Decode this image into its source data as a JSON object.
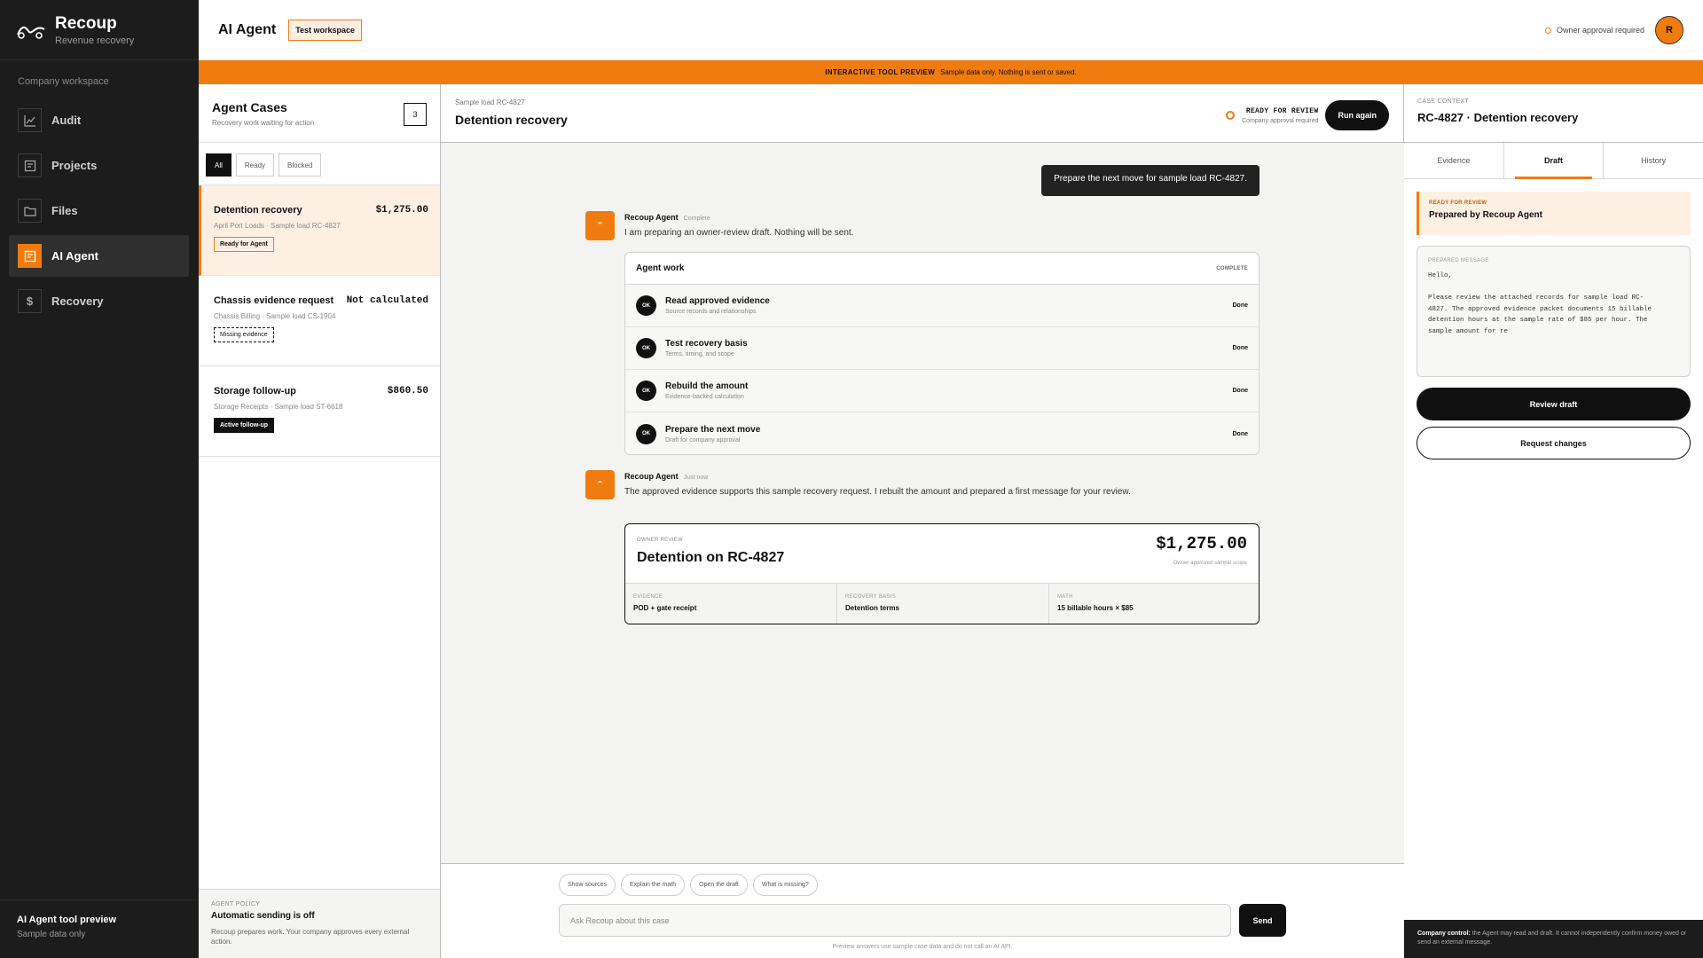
{
  "app": {
    "name": "Recoup",
    "tagline": "Revenue recovery",
    "workspace_label": "Company workspace"
  },
  "nav": [
    {
      "label": "Audit",
      "icon": "chart-icon",
      "active": false
    },
    {
      "label": "Projects",
      "icon": "list-icon",
      "active": false
    },
    {
      "label": "Files",
      "icon": "folder-icon",
      "active": false
    },
    {
      "label": "AI Agent",
      "icon": "agent-icon",
      "active": true
    },
    {
      "label": "Recovery",
      "icon": "dollar-icon",
      "active": false
    }
  ],
  "sidebar_footer": {
    "title": "AI Agent tool preview",
    "subtitle": "Sample data only"
  },
  "header": {
    "title": "AI Agent",
    "workspace_badge": "Test workspace",
    "approval_text": "Owner approval required",
    "avatar_initial": "R"
  },
  "banner": {
    "label": "INTERACTIVE TOOL PREVIEW",
    "text": "Sample data only. Nothing is sent or saved."
  },
  "cases_panel": {
    "title": "Agent Cases",
    "subtitle": "Recovery work waiting for action",
    "count": "3",
    "filters": [
      "All",
      "Ready",
      "Blocked"
    ],
    "cases": [
      {
        "title": "Detention recovery",
        "amount": "$1,275.00",
        "meta": "April Port Loads · Sample load RC-4827",
        "tag": "Ready for Agent"
      },
      {
        "title": "Chassis evidence request",
        "amount": "Not calculated",
        "meta": "Chassis Billing · Sample load CS-1904",
        "tag": "Missing evidence"
      },
      {
        "title": "Storage follow-up",
        "amount": "$860.50",
        "meta": "Storage Receipts · Sample load ST-6618",
        "tag": "Active follow-up"
      }
    ],
    "policy": {
      "label": "AGENT POLICY",
      "title": "Automatic sending is off",
      "text": "Recoup prepares work. Your company approves every external action."
    }
  },
  "chat": {
    "load_label": "Sample load RC-4827",
    "title": "Detention recovery",
    "status": "READY FOR REVIEW",
    "status_sub": "Company approval required",
    "run_again": "Run again",
    "user_message": "Prepare the next move for sample load RC-4827.",
    "agent_name": "Recoup Agent",
    "msg1_time": "Complete",
    "msg1_text": "I am preparing an owner-review draft. Nothing will be sent.",
    "work_title": "Agent work",
    "work_status": "COMPLETE",
    "steps": [
      {
        "name": "Read approved evidence",
        "sub": "Source records and relationships",
        "state": "Done",
        "badge": "OK"
      },
      {
        "name": "Test recovery basis",
        "sub": "Terms, timing, and scope",
        "state": "Done",
        "badge": "OK"
      },
      {
        "name": "Rebuild the amount",
        "sub": "Evidence-backed calculation",
        "state": "Done",
        "badge": "OK"
      },
      {
        "name": "Prepare the next move",
        "sub": "Draft for company approval",
        "state": "Done",
        "badge": "OK"
      }
    ],
    "msg2_time": "Just now",
    "msg2_text": "The approved evidence supports this sample recovery request. I rebuilt the amount and prepared a first message for your review.",
    "review": {
      "label": "OWNER REVIEW",
      "title": "Detention on RC-4827",
      "amount": "$1,275.00",
      "amount_sub": "Owner-approved sample scope",
      "cols": [
        {
          "key": "EVIDENCE",
          "value": "POD + gate receipt"
        },
        {
          "key": "RECOVERY BASIS",
          "value": "Detention terms"
        },
        {
          "key": "MATH",
          "value": "15 billable hours × $85"
        }
      ]
    },
    "suggestions": [
      "Show sources",
      "Explain the math",
      "Open the draft",
      "What is missing?"
    ],
    "input_placeholder": "Ask Recoup about this case",
    "send": "Send",
    "note": "Preview answers use sample case data and do not call an AI API."
  },
  "context": {
    "label": "CASE CONTEXT",
    "title": "RC-4827 · Detention recovery",
    "tabs": [
      "Evidence",
      "Draft",
      "History"
    ],
    "ready_label": "READY FOR REVIEW",
    "ready_title": "Prepared by Recoup Agent",
    "message_label": "PREPARED MESSAGE",
    "message_body": "Hello,\n\nPlease review the attached records for sample load RC-\n4827. The approved evidence packet documents 15 billable\ndetention hours at the sample rate of $85 per hour. The\nsample amount for re",
    "review_draft": "Review draft",
    "request_changes": "Request changes",
    "footer_label": "Company control:",
    "footer_text": "the Agent may read and draft. It cannot independently confirm money owed or send an external message."
  }
}
